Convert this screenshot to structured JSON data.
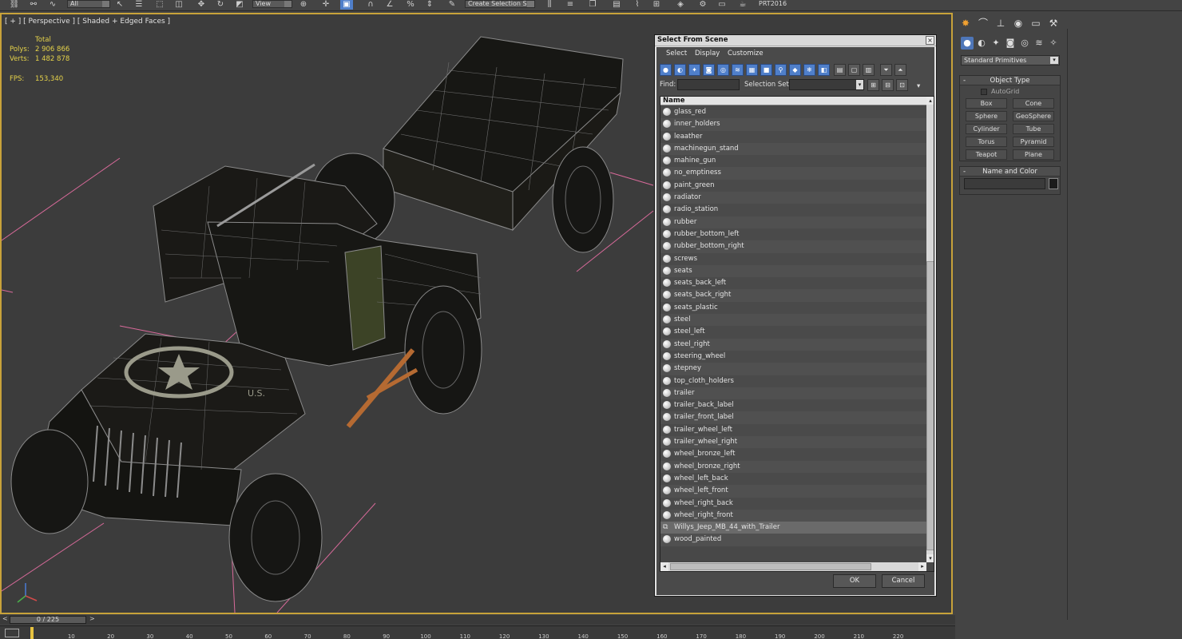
{
  "toolbar": {
    "view_dropdown": "View",
    "selection_set_dropdown": "Create Selection Se",
    "all_dropdown": "All",
    "prt_label": "PRT2016"
  },
  "viewport": {
    "label": "[ + ] [ Perspective ] [ Shaded + Edged Faces ]",
    "stats": {
      "total_label": "Total",
      "polys_label": "Polys:",
      "polys_value": "2 906 866",
      "verts_label": "Verts:",
      "verts_value": "1 482 878",
      "fps_label": "FPS:",
      "fps_value": "153,340"
    },
    "star_text": "U.S.",
    "colors": {
      "border": "#c8a23a",
      "stats": "#e6d34a",
      "grid_line": "#d86a9a"
    }
  },
  "dialog": {
    "title": "Select From Scene",
    "close_label": "×",
    "menu": [
      "Select",
      "Display",
      "Customize"
    ],
    "find_label": "Find:",
    "selection_set_label": "Selection Set:",
    "column_name": "Name",
    "items": [
      {
        "name": "glass_red",
        "icon": "sphere-icon",
        "selected": false
      },
      {
        "name": "inner_holders",
        "icon": "sphere-icon",
        "selected": false
      },
      {
        "name": "leaather",
        "icon": "sphere-icon",
        "selected": false
      },
      {
        "name": "machinegun_stand",
        "icon": "sphere-icon",
        "selected": false
      },
      {
        "name": "mahine_gun",
        "icon": "sphere-icon",
        "selected": false
      },
      {
        "name": "no_emptiness",
        "icon": "sphere-icon",
        "selected": false
      },
      {
        "name": "paint_green",
        "icon": "sphere-icon",
        "selected": false
      },
      {
        "name": "radiator",
        "icon": "sphere-icon",
        "selected": false
      },
      {
        "name": "radio_station",
        "icon": "sphere-icon",
        "selected": false
      },
      {
        "name": "rubber",
        "icon": "sphere-icon",
        "selected": false
      },
      {
        "name": "rubber_bottom_left",
        "icon": "sphere-icon",
        "selected": false
      },
      {
        "name": "rubber_bottom_right",
        "icon": "sphere-icon",
        "selected": false
      },
      {
        "name": "screws",
        "icon": "sphere-icon",
        "selected": false
      },
      {
        "name": "seats",
        "icon": "sphere-icon",
        "selected": false
      },
      {
        "name": "seats_back_left",
        "icon": "sphere-icon",
        "selected": false
      },
      {
        "name": "seats_back_right",
        "icon": "sphere-icon",
        "selected": false
      },
      {
        "name": "seats_plastic",
        "icon": "sphere-icon",
        "selected": false
      },
      {
        "name": "steel",
        "icon": "sphere-icon",
        "selected": false
      },
      {
        "name": "steel_left",
        "icon": "sphere-icon",
        "selected": false
      },
      {
        "name": "steel_right",
        "icon": "sphere-icon",
        "selected": false
      },
      {
        "name": "steering_wheel",
        "icon": "sphere-icon",
        "selected": false
      },
      {
        "name": "stepney",
        "icon": "sphere-icon",
        "selected": false
      },
      {
        "name": "top_cloth_holders",
        "icon": "sphere-icon",
        "selected": false
      },
      {
        "name": "trailer",
        "icon": "sphere-icon",
        "selected": false
      },
      {
        "name": "trailer_back_label",
        "icon": "sphere-icon",
        "selected": false
      },
      {
        "name": "trailer_front_label",
        "icon": "sphere-icon",
        "selected": false
      },
      {
        "name": "trailer_wheel_left",
        "icon": "sphere-icon",
        "selected": false
      },
      {
        "name": "trailer_wheel_right",
        "icon": "sphere-icon",
        "selected": false
      },
      {
        "name": "wheel_bronze_left",
        "icon": "sphere-icon",
        "selected": false
      },
      {
        "name": "wheel_bronze_right",
        "icon": "sphere-icon",
        "selected": false
      },
      {
        "name": "wheel_left_back",
        "icon": "sphere-icon",
        "selected": false
      },
      {
        "name": "wheel_left_front",
        "icon": "sphere-icon",
        "selected": false
      },
      {
        "name": "wheel_right_back",
        "icon": "sphere-icon",
        "selected": false
      },
      {
        "name": "wheel_right_front",
        "icon": "sphere-icon",
        "selected": false
      },
      {
        "name": "Willys_Jeep_MB_44_with_Trailer",
        "icon": "group-icon",
        "selected": true
      },
      {
        "name": "wood_painted",
        "icon": "sphere-icon",
        "selected": false
      }
    ],
    "ok_label": "OK",
    "cancel_label": "Cancel"
  },
  "command_panel": {
    "category_dropdown": "Standard Primitives",
    "object_type_title": "Object Type",
    "autogrid_label": "AutoGrid",
    "primitives": [
      "Box",
      "Cone",
      "Sphere",
      "GeoSphere",
      "Cylinder",
      "Tube",
      "Torus",
      "Pyramid",
      "Teapot",
      "Plane"
    ],
    "name_color_title": "Name and Color",
    "rollout_collapse": "-"
  },
  "timeline": {
    "frame_display": "0 / 225",
    "prev_arrow": "<",
    "next_arrow": ">",
    "ticks": [
      "10",
      "20",
      "30",
      "40",
      "50",
      "60",
      "70",
      "80",
      "90",
      "100",
      "110",
      "120",
      "130",
      "140",
      "150",
      "160",
      "170",
      "180",
      "190",
      "200",
      "210",
      "220"
    ]
  }
}
